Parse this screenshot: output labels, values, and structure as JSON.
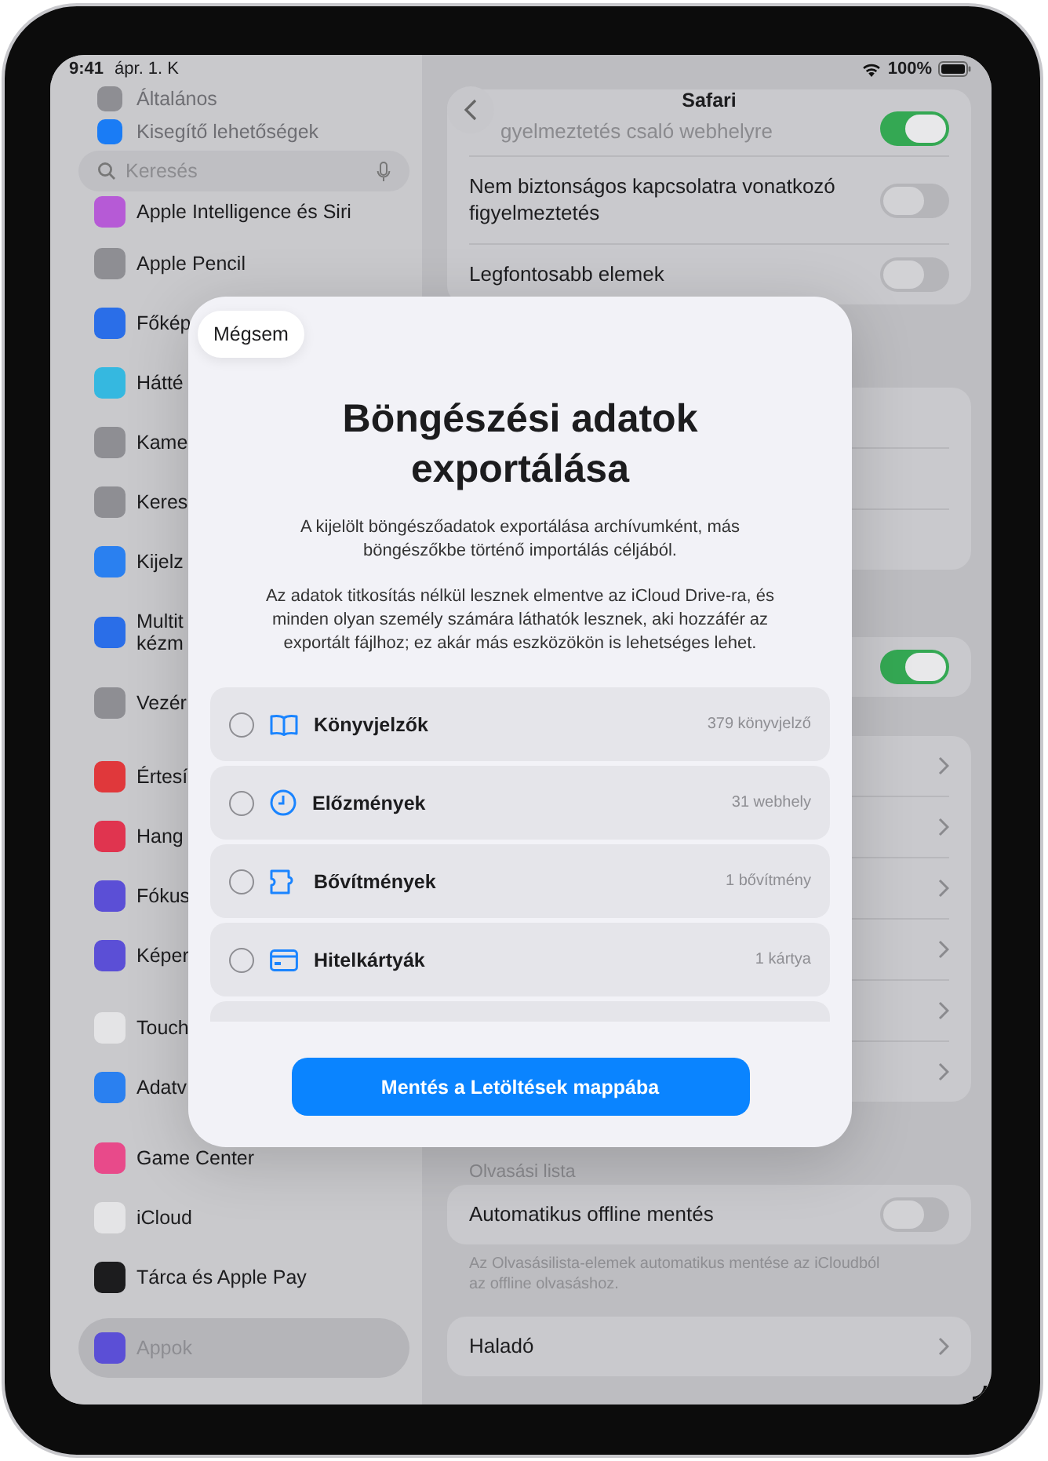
{
  "status_bar": {
    "time": "9:41",
    "date": "ápr. 1. K",
    "battery": "100%"
  },
  "sidebar": {
    "search": {
      "placeholder": "Keresés"
    },
    "groups": [
      [
        {
          "label": "Általános",
          "color": "#8e8e93",
          "faded": true,
          "selected": false
        },
        {
          "label": "Kisegítő lehetőségek",
          "color": "#1a7cf5",
          "faded": true,
          "selected": false
        },
        {
          "label": "Apple Intelligence és Siri",
          "color": "#b65ad6",
          "faded": false,
          "selected": false
        },
        {
          "label": "Apple Pencil",
          "color": "#8e8e93",
          "faded": false,
          "selected": false
        },
        {
          "label": "Főkép",
          "color": "#2a6ee8",
          "faded": false,
          "selected": false
        },
        {
          "label": "Hátté",
          "color": "#35b8e0",
          "faded": false,
          "selected": false
        },
        {
          "label": "Kame",
          "color": "#8e8e93",
          "faded": false,
          "selected": false
        },
        {
          "label": "Keres",
          "color": "#8e8e93",
          "faded": false,
          "selected": false
        },
        {
          "label": "Kijelz",
          "color": "#2a80f0",
          "faded": false,
          "selected": false
        },
        {
          "label": "Multit\nkézm",
          "color": "#2a6ee8",
          "faded": false,
          "selected": false
        },
        {
          "label": "Vezér",
          "color": "#8e8e93",
          "faded": false,
          "selected": false
        }
      ],
      [
        {
          "label": "Értesí",
          "color": "#e0383b",
          "faded": false,
          "selected": false
        },
        {
          "label": "Hang",
          "color": "#e0344f",
          "faded": false,
          "selected": false
        },
        {
          "label": "Fókus",
          "color": "#5b4fd6",
          "faded": false,
          "selected": false
        },
        {
          "label": "Képer",
          "color": "#5b4fd6",
          "faded": false,
          "selected": false
        }
      ],
      [
        {
          "label": "Touch",
          "color": "#e4e4e6",
          "faded": false,
          "selected": false
        },
        {
          "label": "Adatv",
          "color": "#2a80f0",
          "faded": false,
          "selected": false
        }
      ],
      [
        {
          "label": "Game Center",
          "color": "#e84a8a",
          "faded": false,
          "selected": false
        },
        {
          "label": "iCloud",
          "color": "#e4e4e6",
          "faded": false,
          "selected": false
        },
        {
          "label": "Tárca és Apple Pay",
          "color": "#1c1c1e",
          "faded": false,
          "selected": false
        }
      ],
      [
        {
          "label": "Appok",
          "color": "#5b4fd6",
          "faded": false,
          "selected": true
        }
      ]
    ]
  },
  "detail": {
    "title": "Safari",
    "groups": [
      {
        "rows": [
          {
            "label": "gyelmeztetés csaló webhelyre",
            "kind": "toggle",
            "on": true
          },
          {
            "label": "Nem biztonságos kapcsolatra vonatkozó figyelmeztetés",
            "kind": "toggle",
            "on": false
          },
          {
            "label": "Legfontosabb elemek",
            "kind": "toggle",
            "on": false
          }
        ]
      },
      {
        "rows": [
          {
            "kind": "blank"
          },
          {
            "kind": "blank"
          },
          {
            "kind": "blank"
          }
        ]
      },
      {
        "rows": [
          {
            "kind": "toggle",
            "on": true
          }
        ]
      },
      {
        "rows": [
          {
            "kind": "link"
          },
          {
            "kind": "link"
          },
          {
            "kind": "link"
          },
          {
            "kind": "link"
          },
          {
            "kind": "link"
          },
          {
            "kind": "link"
          }
        ]
      },
      {
        "header": "Olvasási lista",
        "rows": [
          {
            "label": "Automatikus offline mentés",
            "kind": "toggle",
            "on": false
          }
        ],
        "footer": "Az Olvasásilista-elemek automatikus mentése az iCloudból az offline olvasáshoz."
      },
      {
        "rows": [
          {
            "label": "Haladó",
            "kind": "link"
          }
        ]
      }
    ]
  },
  "modal": {
    "cancel": "Mégsem",
    "title": "Böngészési adatok exportálása",
    "paragraphs": [
      "A kijelölt böngészőadatok exportálása archívumként, más böngészőkbe történő importálás céljából.",
      "Az adatok titkosítás nélkül lesznek elmentve az iCloud Drive-ra, és minden olyan személy számára láthatók lesznek, aki hozzáfér az exportált fájlhoz; ez akár más eszközökön is lehetséges lehet."
    ],
    "options": [
      {
        "label": "Könyvjelzők",
        "count": "379 könyvjelző",
        "selected": false
      },
      {
        "label": "Előzmények",
        "count": "31 webhely",
        "selected": false
      },
      {
        "label": "Bővítmények",
        "count": "1 bővítmény",
        "selected": false
      },
      {
        "label": "Hitelkártyák",
        "count": "1 kártya",
        "selected": false
      }
    ],
    "button": "Mentés a Letöltések mappába"
  }
}
